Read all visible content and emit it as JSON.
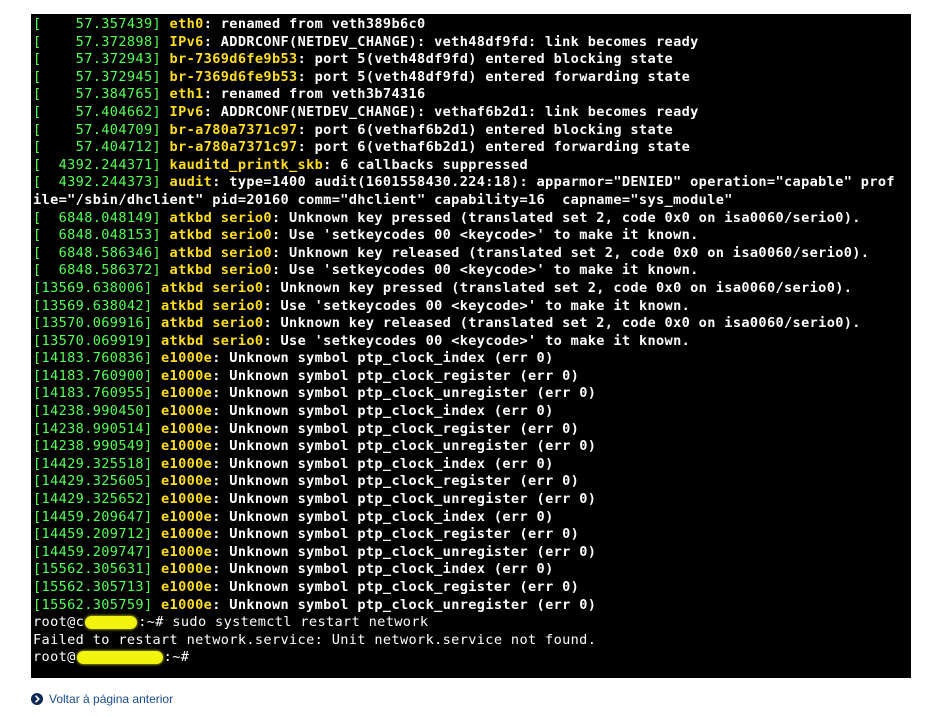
{
  "terminal": {
    "log": [
      {
        "ts": "[    57.357439] ",
        "src": "eth0",
        "msg": ": renamed from veth389b6c0"
      },
      {
        "ts": "[    57.372898] ",
        "src": "IPv6",
        "msg": ": ADDRCONF(NETDEV_CHANGE): veth48df9fd: link becomes ready"
      },
      {
        "ts": "[    57.372943] ",
        "src": "br-7369d6fe9b53",
        "msg": ": port 5(veth48df9fd) entered blocking state"
      },
      {
        "ts": "[    57.372945] ",
        "src": "br-7369d6fe9b53",
        "msg": ": port 5(veth48df9fd) entered forwarding state"
      },
      {
        "ts": "[    57.384765] ",
        "src": "eth1",
        "msg": ": renamed from veth3b74316"
      },
      {
        "ts": "[    57.404662] ",
        "src": "IPv6",
        "msg": ": ADDRCONF(NETDEV_CHANGE): vethaf6b2d1: link becomes ready"
      },
      {
        "ts": "[    57.404709] ",
        "src": "br-a780a7371c97",
        "msg": ": port 6(vethaf6b2d1) entered blocking state"
      },
      {
        "ts": "[    57.404712] ",
        "src": "br-a780a7371c97",
        "msg": ": port 6(vethaf6b2d1) entered forwarding state"
      },
      {
        "ts": "[  4392.244371] ",
        "src": "kauditd_printk_skb",
        "msg": ": 6 callbacks suppressed"
      },
      {
        "ts": "[  4392.244373] ",
        "src": "audit",
        "msg": ": type=1400 audit(1601558430.224:18): apparmor=\"DENIED\" operation=\"capable\" prof"
      },
      {
        "wrap": "ile=\"/sbin/dhclient\" pid=20160 comm=\"dhclient\" capability=16  capname=\"sys_module\""
      },
      {
        "ts": "[  6848.048149] ",
        "src": "atkbd serio0",
        "msg": ": Unknown key pressed (translated set 2, code 0x0 on isa0060/serio0)."
      },
      {
        "ts": "[  6848.048153] ",
        "src": "atkbd serio0",
        "msg": ": Use 'setkeycodes 00 <keycode>' to make it known."
      },
      {
        "ts": "[  6848.586346] ",
        "src": "atkbd serio0",
        "msg": ": Unknown key released (translated set 2, code 0x0 on isa0060/serio0)."
      },
      {
        "ts": "[  6848.586372] ",
        "src": "atkbd serio0",
        "msg": ": Use 'setkeycodes 00 <keycode>' to make it known."
      },
      {
        "ts": "[13569.638006] ",
        "src": "atkbd serio0",
        "msg": ": Unknown key pressed (translated set 2, code 0x0 on isa0060/serio0)."
      },
      {
        "ts": "[13569.638042] ",
        "src": "atkbd serio0",
        "msg": ": Use 'setkeycodes 00 <keycode>' to make it known."
      },
      {
        "ts": "[13570.069916] ",
        "src": "atkbd serio0",
        "msg": ": Unknown key released (translated set 2, code 0x0 on isa0060/serio0)."
      },
      {
        "ts": "[13570.069919] ",
        "src": "atkbd serio0",
        "msg": ": Use 'setkeycodes 00 <keycode>' to make it known."
      },
      {
        "ts": "[14183.760836] ",
        "src": "e1000e",
        "msg": ": Unknown symbol ptp_clock_index (err 0)"
      },
      {
        "ts": "[14183.760900] ",
        "src": "e1000e",
        "msg": ": Unknown symbol ptp_clock_register (err 0)"
      },
      {
        "ts": "[14183.760955] ",
        "src": "e1000e",
        "msg": ": Unknown symbol ptp_clock_unregister (err 0)"
      },
      {
        "ts": "[14238.990450] ",
        "src": "e1000e",
        "msg": ": Unknown symbol ptp_clock_index (err 0)"
      },
      {
        "ts": "[14238.990514] ",
        "src": "e1000e",
        "msg": ": Unknown symbol ptp_clock_register (err 0)"
      },
      {
        "ts": "[14238.990549] ",
        "src": "e1000e",
        "msg": ": Unknown symbol ptp_clock_unregister (err 0)"
      },
      {
        "ts": "[14429.325518] ",
        "src": "e1000e",
        "msg": ": Unknown symbol ptp_clock_index (err 0)"
      },
      {
        "ts": "[14429.325605] ",
        "src": "e1000e",
        "msg": ": Unknown symbol ptp_clock_register (err 0)"
      },
      {
        "ts": "[14429.325652] ",
        "src": "e1000e",
        "msg": ": Unknown symbol ptp_clock_unregister (err 0)"
      },
      {
        "ts": "[14459.209647] ",
        "src": "e1000e",
        "msg": ": Unknown symbol ptp_clock_index (err 0)"
      },
      {
        "ts": "[14459.209712] ",
        "src": "e1000e",
        "msg": ": Unknown symbol ptp_clock_register (err 0)"
      },
      {
        "ts": "[14459.209747] ",
        "src": "e1000e",
        "msg": ": Unknown symbol ptp_clock_unregister (err 0)"
      },
      {
        "ts": "[15562.305631] ",
        "src": "e1000e",
        "msg": ": Unknown symbol ptp_clock_index (err 0)"
      },
      {
        "ts": "[15562.305713] ",
        "src": "e1000e",
        "msg": ": Unknown symbol ptp_clock_register (err 0)"
      },
      {
        "ts": "[15562.305759] ",
        "src": "e1000e",
        "msg": ": Unknown symbol ptp_clock_unregister (err 0)"
      }
    ],
    "prompt_1_start": "root@c",
    "prompt_1_end": ":~# ",
    "command": "sudo systemctl restart network",
    "error_output": "Failed to restart network.service: Unit network.service not found.",
    "prompt_2_start": "root@",
    "prompt_2_end": ":~# ",
    "colors": {
      "background": "#000000",
      "timestamp": "#55ff55",
      "source": "#ffdd22",
      "text": "#ffffff",
      "redaction": "#f2f20f"
    }
  },
  "footer": {
    "back_icon": "chevron-right-circle-icon",
    "back_link_label": "Voltar à página anterior"
  }
}
